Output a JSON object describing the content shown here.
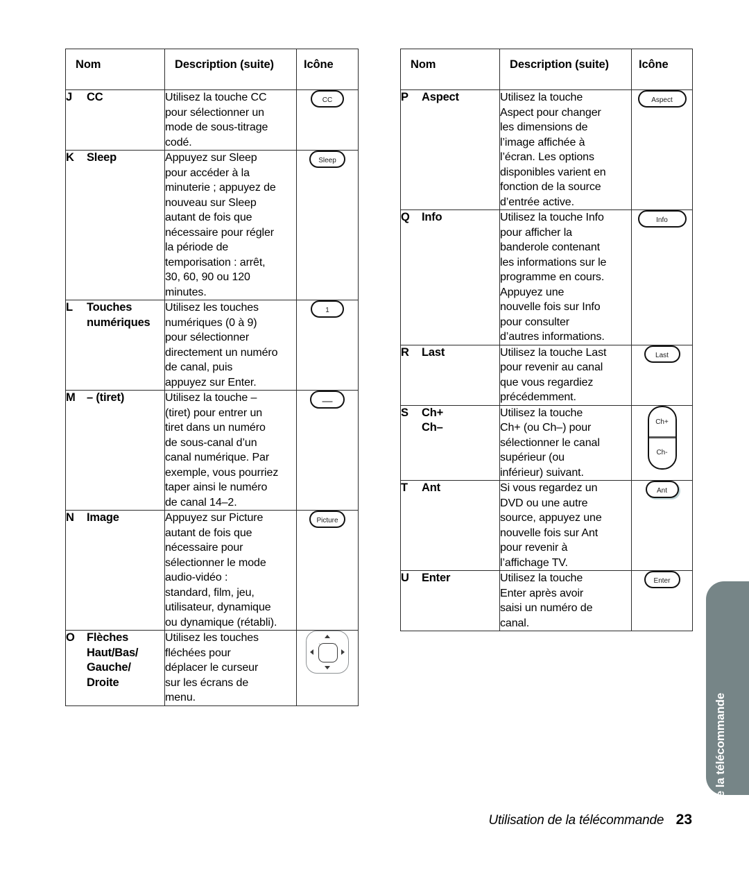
{
  "page": {
    "footer_title": "Utilisation de la télécommande",
    "footer_page_number": "23",
    "side_tab_label": "Utilisation de la télécommande",
    "side_tab_color": "#768587"
  },
  "tables": {
    "left": {
      "headers": {
        "name": "Nom",
        "description": "Description (suite)",
        "icon": "Icône"
      },
      "rows": [
        {
          "letter": "J",
          "name": "CC",
          "description": "Utilisez la touche CC\npour sélectionner un\nmode de sous-titrage\ncodé.",
          "icon_label": "CC",
          "icon_type": "pill-small"
        },
        {
          "letter": "K",
          "name": "Sleep",
          "description": "Appuyez sur Sleep\npour accéder à la\nminuterie ; appuyez de\nnouveau sur Sleep\nautant de fois que\nnécessaire pour régler\nla période de\ntemporisation : arrêt,\n30, 60, 90 ou 120\nminutes.",
          "icon_label": "Sleep",
          "icon_type": "pill-med"
        },
        {
          "letter": "L",
          "name": "Touches\nnumériques",
          "description": "Utilisez les touches\nnumériques (0 à 9)\npour sélectionner\ndirectement un numéro\nde canal, puis\nappuyez sur Enter.",
          "icon_label": "1",
          "icon_type": "pill-small"
        },
        {
          "letter": "M",
          "name": "– (tiret)",
          "description": "Utilisez la touche –\n(tiret) pour entrer un\ntiret dans un numéro\nde sous-canal d’un\ncanal numérique. Par\nexemple, vous pourriez\ntaper ainsi le numéro\nde canal 14–2.",
          "icon_label": "—",
          "icon_type": "pill-dash"
        },
        {
          "letter": "N",
          "name": "Image",
          "description": "Appuyez sur Picture\nautant de fois que\nnécessaire pour\nsélectionner le mode\naudio-vidéo :\nstandard, film, jeu,\nutilisateur, dynamique\nou dynamique (rétabli).",
          "icon_label": "Picture",
          "icon_type": "pill-med"
        },
        {
          "letter": "O",
          "name": "Flèches\nHaut/Bas/\nGauche/\nDroite",
          "description": "Utilisez les touches\nfléchées pour\ndéplacer le curseur\nsur les écrans de\nmenu.",
          "icon_label": "",
          "icon_type": "dpad"
        }
      ]
    },
    "right": {
      "headers": {
        "name": "Nom",
        "description": "Description (suite)",
        "icon": "Icône"
      },
      "rows": [
        {
          "letter": "P",
          "name": "Aspect",
          "description": "Utilisez la touche\nAspect pour changer\nles dimensions de\nl’image affichée à\nl’écran. Les options\ndisponibles varient en\nfonction de la source\nd’entrée active.",
          "icon_label": "Aspect",
          "icon_type": "pill-wide"
        },
        {
          "letter": "Q",
          "name": "Info",
          "description": "Utilisez la touche Info\npour afficher la\nbanderole contenant\nles informations sur le\nprogramme en cours.\nAppuyez une\nnouvelle fois sur Info\npour consulter\nd’autres informations.",
          "icon_label": "Info",
          "icon_type": "pill-wide"
        },
        {
          "letter": "R",
          "name": "Last",
          "description": "Utilisez la touche Last\npour revenir au canal\nque vous regardiez\nprécédemment.",
          "icon_label": "Last",
          "icon_type": "pill-med"
        },
        {
          "letter": "S",
          "name": "Ch+\nCh–",
          "description": "Utilisez la touche\nCh+ (ou Ch–) pour\nsélectionner le canal\nsupérieur (ou\ninférieur) suivant.",
          "icon_label": "Ch+",
          "icon_label_2": "Ch-",
          "icon_type": "rocker"
        },
        {
          "letter": "T",
          "name": "Ant",
          "description": "Si vous regardez un\nDVD ou une autre\nsource, appuyez une\nnouvelle fois sur Ant\npour revenir à\nl’affichage TV.",
          "icon_label": "Ant",
          "icon_type": "pill-small-shadow"
        },
        {
          "letter": "U",
          "name": "Enter",
          "description": "Utilisez la touche\nEnter après avoir\nsaisi un numéro de\ncanal.",
          "icon_label": "Enter",
          "icon_type": "pill-med"
        }
      ]
    }
  }
}
